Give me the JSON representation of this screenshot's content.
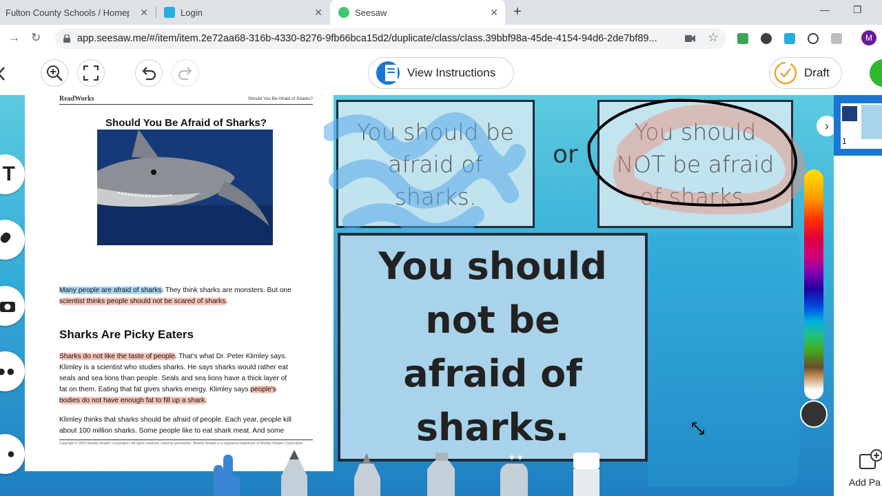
{
  "browser": {
    "tabs": [
      {
        "label": "Fulton County Schools / Homep..."
      },
      {
        "label": "Login"
      },
      {
        "label": "Seesaw"
      }
    ],
    "url": "app.seesaw.me/#/item/item.2e72aa68-316b-4330-8276-9fb66bca15d2/duplicate/class/class.39bbf98a-45de-4154-94d6-2de7bf89...",
    "profile_initial": "M"
  },
  "toolbar": {
    "view_instructions": "View Instructions",
    "draft": "Draft"
  },
  "article": {
    "brand": "ReadWorks",
    "header_right": "Should You Be Afraid of Sharks?",
    "title": "Should You Be Afraid of Sharks?",
    "p1_hl": "Many people are afraid of sharks.",
    "p1_rest": " They think sharks are monsters. But one",
    "p1_line2": "scientist thinks people should not be scared of sharks.",
    "subhead": "Sharks Are Picky Eaters",
    "p2_hl": "Sharks do not like the taste of people.",
    "p2_a": " That's what Dr. Peter Klimley says.",
    "p2_line2": "Klimley is a scientist who studies sharks. He says sharks would rather eat",
    "p2_line3": "seals and sea lions than people. Seals and sea lions have a thick layer of",
    "p2_line4a": "fat on them. Eating that fat gives sharks energy. Klimley says ",
    "p2_line4hl": "people's",
    "p2_line5": "bodies do not have enough fat to fill up a shark.",
    "p3_line1": "Klimley thinks that sharks should be afraid of people. Each year, people kill",
    "p3_line2": "about 100 million sharks. Some people like to eat shark meat. And some",
    "footer": "Copyright © 2015 Weekly Reader Corporation. All rights reserved. Used by permission. Weekly Reader is a registered trademark of Weekly Reader Corporation."
  },
  "cards": {
    "option_a": "You should be afraid of sharks.",
    "or": "or",
    "option_b": "You should NOT be afraid of sharks.",
    "answer": "You should not be afraid of sharks."
  },
  "rail": {
    "page_number": "1",
    "add_page": "Add Pa"
  },
  "colors": {
    "seesaw_blue": "#1976d2",
    "draft_ring": "#f0a030",
    "selected_color": "#333333"
  }
}
